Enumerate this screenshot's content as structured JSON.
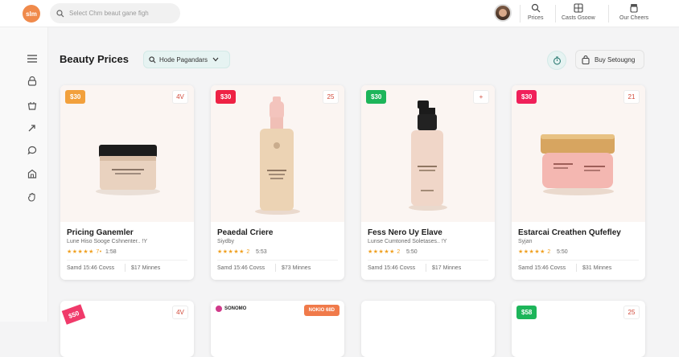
{
  "header": {
    "logo_text": "slm",
    "search_placeholder": "Select Chm beaut gane figh",
    "nav": [
      {
        "label": "Prices",
        "icon": "search-icon"
      },
      {
        "label": "Casts Gsoow",
        "icon": "grid-icon"
      },
      {
        "label": "Our Cheers",
        "icon": "jar-icon"
      }
    ]
  },
  "sidebar": {
    "icons": [
      "menu-icon",
      "lock-icon",
      "basket-icon",
      "arrow-icon",
      "chat-icon",
      "store-icon",
      "hand-icon"
    ]
  },
  "toolbar": {
    "title": "Beauty Prices",
    "filter_label": "Hode Pagandars",
    "buy_label": "Buy Setougng"
  },
  "products": [
    {
      "price": "$30",
      "price_color": "#f2a03c",
      "corner": "4V",
      "name": "Pricing Ganemler",
      "sub": "Lune Hiso Sooge Cshnenter.. !Y",
      "stars": "★★★★★ 7•",
      "count": "1:58",
      "meta1": "Samd 15:46 Covss",
      "meta2": "$17 Minnes"
    },
    {
      "price": "$30",
      "price_color": "#ee2244",
      "corner": "25",
      "name": "Peaedal Criere",
      "sub": "Siydby",
      "stars": "★★★★★ 2",
      "count": "5:53",
      "meta1": "Samd 15:46 Covss",
      "meta2": "$73 Minnes"
    },
    {
      "price": "$30",
      "price_color": "#1db55a",
      "corner": "+",
      "name": "Fess Nero Uy Elave",
      "sub": "Lunse Cumtoned Soletases.. !Y",
      "stars": "★★★★★ 2",
      "count": "5:50",
      "meta1": "Samd 15:46 Covss",
      "meta2": "$17 Minnes"
    },
    {
      "price": "$30",
      "price_color": "#f0205a",
      "corner": "21",
      "name": "Estarcai Creathen Qufefley",
      "sub": "Syjan",
      "stars": "★★★★★ 2",
      "count": "5:50",
      "meta1": "Samd 15:46 Covss",
      "meta2": "$31 Minnes"
    }
  ],
  "second_row": {
    "card1_price": "$50",
    "card1_corner": "4V",
    "card2_brand": "SONOMO",
    "card2_promo": "NOKIO 68D",
    "card4_price": "$58",
    "card4_corner": "25"
  },
  "colors": {
    "accent": "#f08a4b",
    "teal_bg": "#e6f3f2"
  }
}
